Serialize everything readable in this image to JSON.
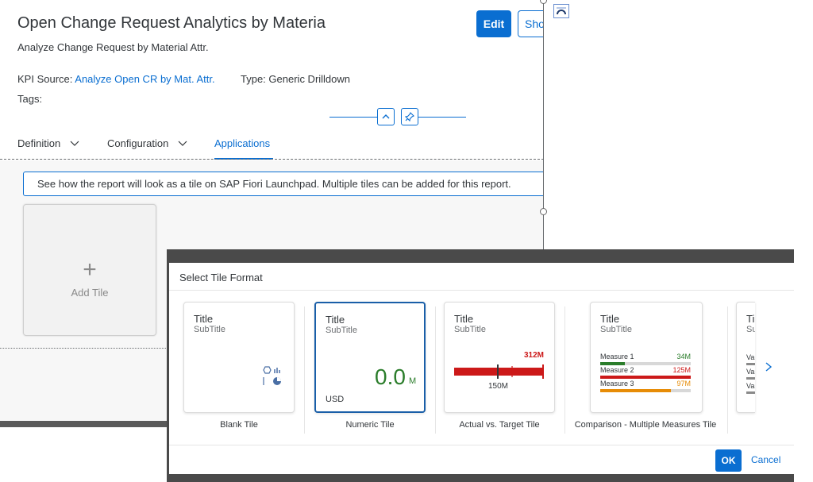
{
  "header": {
    "title": "Open Change Request Analytics by Materia",
    "subtitle": "Analyze Change Request by Material Attr.",
    "edit_label": "Edit",
    "show_label": "Sho",
    "kpi_source_label": "KPI Source:",
    "kpi_source_value": "Analyze Open CR by Mat. Attr.",
    "type_label": "Type:",
    "type_value": "Generic Drilldown",
    "tags_label": "Tags:"
  },
  "tabs": [
    {
      "label": "Definition",
      "has_dropdown": true
    },
    {
      "label": "Configuration",
      "has_dropdown": true
    },
    {
      "label": "Applications",
      "active": true
    }
  ],
  "content": {
    "info_text": "See how the report will look as a tile on SAP Fiori Launchpad. Multiple tiles can be added for this report.",
    "add_tile_label": "Add Tile"
  },
  "dialog": {
    "title": "Select Tile Format",
    "tiles": [
      {
        "title": "Title",
        "subtitle": "SubTitle",
        "caption": "Blank Tile"
      },
      {
        "title": "Title",
        "subtitle": "SubTitle",
        "caption": "Numeric Tile",
        "value": "0.0",
        "unit": "M",
        "currency": "USD",
        "selected": true
      },
      {
        "title": "Title",
        "subtitle": "SubTitle",
        "caption": "Actual vs. Target Tile",
        "actual": "312M",
        "target": "150M"
      },
      {
        "title": "Title",
        "subtitle": "SubTitle",
        "caption": "Comparison - Multiple Measures Tile",
        "measures": [
          {
            "label": "Measure 1",
            "value": "34M",
            "color": "#2b7d2b",
            "fraction": 0.27
          },
          {
            "label": "Measure 2",
            "value": "125M",
            "color": "#cc1919",
            "fraction": 1.0
          },
          {
            "label": "Measure 3",
            "value": "97M",
            "color": "#e78c07",
            "fraction": 0.78
          }
        ]
      },
      {
        "title": "Ti",
        "subtitle": "Su",
        "caption": "",
        "row_labels": [
          "Va",
          "Va",
          "Va"
        ]
      }
    ],
    "ok_label": "OK",
    "cancel_label": "Cancel"
  },
  "colors": {
    "accent": "#0a6ed1",
    "positive": "#2b7d2b",
    "negative": "#cc1919",
    "critical": "#e78c07"
  }
}
